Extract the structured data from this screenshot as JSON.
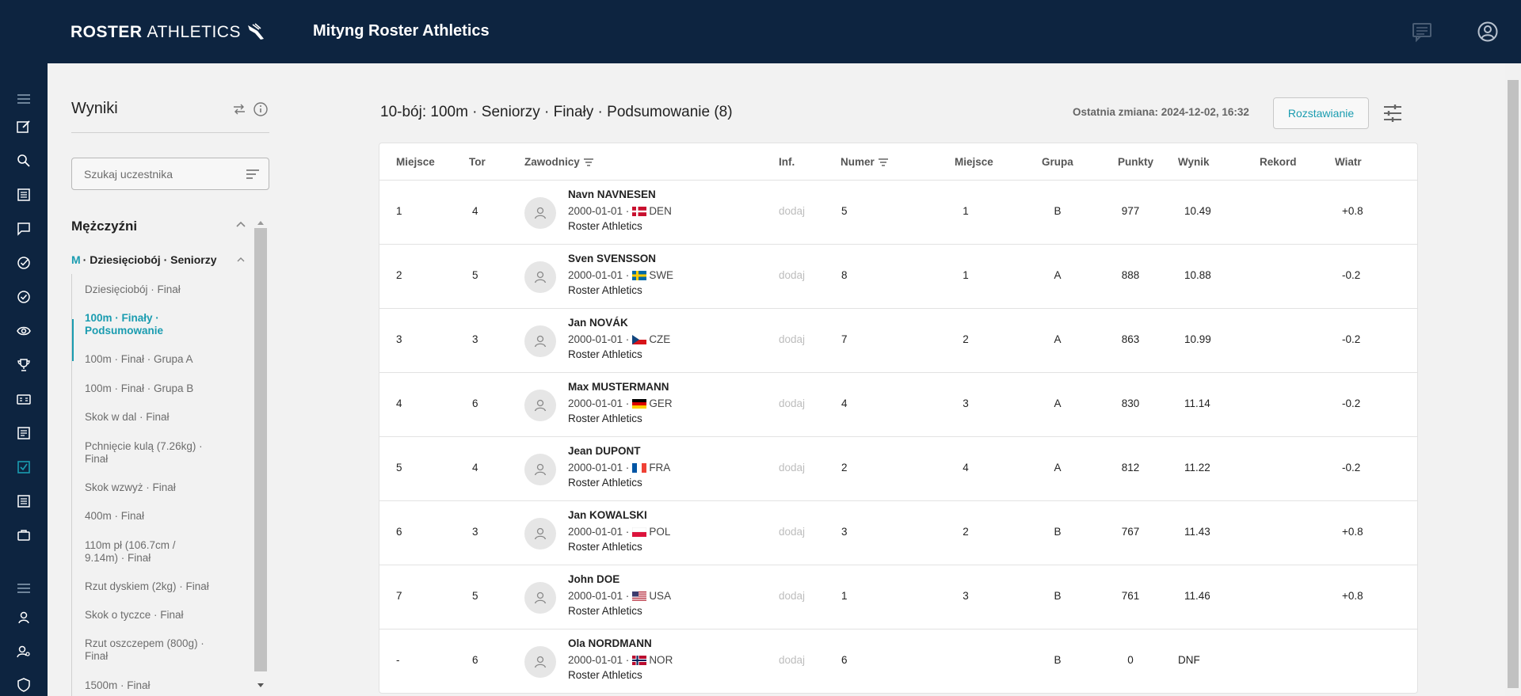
{
  "header": {
    "brand_bold": "ROSTER",
    "brand_light": "ATHLETICS",
    "meet_title": "Mityng Roster Athletics"
  },
  "rail_icons": [
    "menu-icon",
    "edit-icon",
    "search-icon",
    "list-icon",
    "chat-icon",
    "check-circle-icon",
    "check-circle-icon",
    "eye-icon",
    "trophy-icon",
    "scoreboard-icon",
    "results-icon",
    "checkbox-icon",
    "list-icon",
    "briefcase-icon",
    "menu-icon",
    "user-icon",
    "user-search-icon",
    "shield-icon"
  ],
  "sidebar": {
    "title": "Wyniki",
    "search_placeholder": "Szukaj uczestnika",
    "section": "Mężczyźni",
    "group_prefix": "M",
    "group_title": "· Dziesięciobój · Seniorzy",
    "events": [
      {
        "label": "Dziesięciobój · Finał",
        "active": false
      },
      {
        "label": "100m · Finały · Podsumowanie",
        "active": true
      },
      {
        "label": "100m · Finał · Grupa A",
        "active": false
      },
      {
        "label": "100m · Finał · Grupa B",
        "active": false
      },
      {
        "label": "Skok w dal · Finał",
        "active": false
      },
      {
        "label": "Pchnięcie kulą (7.26kg) · Finał",
        "active": false
      },
      {
        "label": "Skok wzwyż · Finał",
        "active": false
      },
      {
        "label": "400m · Finał",
        "active": false
      },
      {
        "label": "110m pł (106.7cm / 9.14m) · Finał",
        "active": false
      },
      {
        "label": "Rzut dyskiem (2kg) · Finał",
        "active": false
      },
      {
        "label": "Skok o tyczce · Finał",
        "active": false
      },
      {
        "label": "Rzut oszczepem (800g) · Finał",
        "active": false
      },
      {
        "label": "1500m · Finał",
        "active": false
      }
    ]
  },
  "main": {
    "title": "10-bój: 100m · Seniorzy · Finały · Podsumowanie (8)",
    "last_change": "Ostatnia zmiana: 2024-12-02, 16:32",
    "rozstawianie": "Rozstawianie"
  },
  "table": {
    "headers": {
      "place": "Miejsce",
      "lane": "Tor",
      "athletes": "Zawodnicy",
      "info": "Inf.",
      "number": "Numer",
      "place2": "Miejsce",
      "group": "Grupa",
      "points": "Punkty",
      "result": "Wynik",
      "record": "Rekord",
      "wind": "Wiatr"
    },
    "add_label": "dodaj",
    "rows": [
      {
        "place": "1",
        "lane": "4",
        "name": "Navn NAVNESEN",
        "dob": "2000-01-01 ·",
        "country": "DEN",
        "club": "Roster Athletics",
        "number": "5",
        "place2": "1",
        "group": "B",
        "points": "977",
        "result": "10.49",
        "wind": "+0.8"
      },
      {
        "place": "2",
        "lane": "5",
        "name": "Sven SVENSSON",
        "dob": "2000-01-01 ·",
        "country": "SWE",
        "club": "Roster Athletics",
        "number": "8",
        "place2": "1",
        "group": "A",
        "points": "888",
        "result": "10.88",
        "wind": "-0.2"
      },
      {
        "place": "3",
        "lane": "3",
        "name": "Jan NOVÁK",
        "dob": "2000-01-01 ·",
        "country": "CZE",
        "club": "Roster Athletics",
        "number": "7",
        "place2": "2",
        "group": "A",
        "points": "863",
        "result": "10.99",
        "wind": "-0.2"
      },
      {
        "place": "4",
        "lane": "6",
        "name": "Max MUSTERMANN",
        "dob": "2000-01-01 ·",
        "country": "GER",
        "club": "Roster Athletics",
        "number": "4",
        "place2": "3",
        "group": "A",
        "points": "830",
        "result": "11.14",
        "wind": "-0.2"
      },
      {
        "place": "5",
        "lane": "4",
        "name": "Jean DUPONT",
        "dob": "2000-01-01 ·",
        "country": "FRA",
        "club": "Roster Athletics",
        "number": "2",
        "place2": "4",
        "group": "A",
        "points": "812",
        "result": "11.22",
        "wind": "-0.2"
      },
      {
        "place": "6",
        "lane": "3",
        "name": "Jan KOWALSKI",
        "dob": "2000-01-01 ·",
        "country": "POL",
        "club": "Roster Athletics",
        "number": "3",
        "place2": "2",
        "group": "B",
        "points": "767",
        "result": "11.43",
        "wind": "+0.8"
      },
      {
        "place": "7",
        "lane": "5",
        "name": "John DOE",
        "dob": "2000-01-01 ·",
        "country": "USA",
        "club": "Roster Athletics",
        "number": "1",
        "place2": "3",
        "group": "B",
        "points": "761",
        "result": "11.46",
        "wind": "+0.8"
      },
      {
        "place": "-",
        "lane": "6",
        "name": "Ola NORDMANN",
        "dob": "2000-01-01 ·",
        "country": "NOR",
        "club": "Roster Athletics",
        "number": "6",
        "place2": "",
        "group": "B",
        "points": "0",
        "result": "DNF",
        "wind": ""
      }
    ]
  },
  "colors": {
    "navy": "#0d2440",
    "accent": "#1a9cb0"
  }
}
